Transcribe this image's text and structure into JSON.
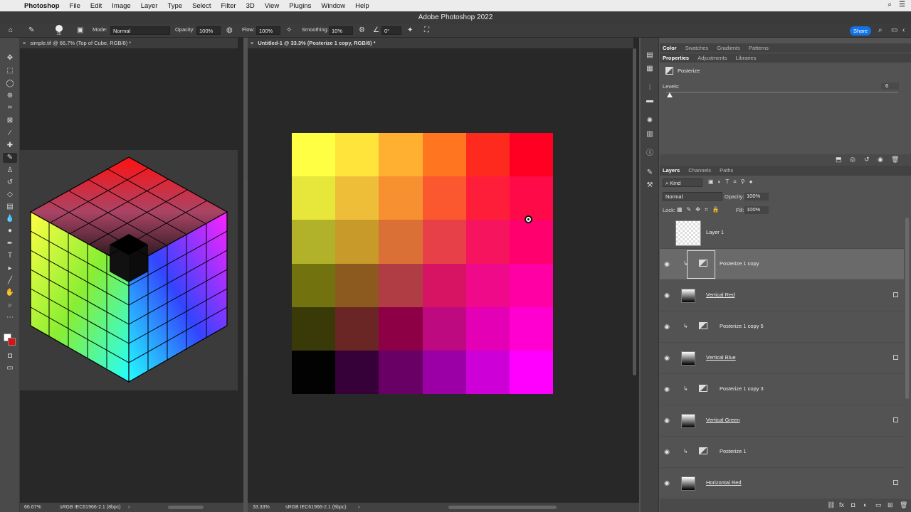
{
  "menubar": {
    "apple": "",
    "app": "Photoshop",
    "items": [
      "File",
      "Edit",
      "Image",
      "Layer",
      "Type",
      "Select",
      "Filter",
      "3D",
      "View",
      "Plugins",
      "Window",
      "Help"
    ],
    "right_icons": [
      "search-icon",
      "control-center-icon"
    ]
  },
  "window": {
    "title": "Adobe Photoshop 2022"
  },
  "options": {
    "brush_size": "25",
    "mode_label": "Mode:",
    "mode_value": "Normal",
    "opacity_label": "Opacity:",
    "opacity_value": "100%",
    "flow_label": "Flow:",
    "flow_value": "100%",
    "smoothing_label": "Smoothing:",
    "smoothing_value": "10%",
    "angle_value": "0°",
    "share_label": "Share"
  },
  "docs": [
    {
      "tab": "simple.tif @ 66.7% (Top of Cube, RGB/8) *",
      "zoom": "66.67%",
      "profile": "sRGB IEC61966-2.1 (8bpc)"
    },
    {
      "tab": "Untitled-1 @ 33.3% (Posterize 1 copy, RGB/8) *",
      "zoom": "33.33%",
      "profile": "sRGB IEC61966-2.1 (8bpc)"
    }
  ],
  "grid_colors": [
    [
      "#ffff44",
      "#ffe43c",
      "#ffb030",
      "#ff7520",
      "#ff2a1e",
      "#ff0022"
    ],
    [
      "#e7e63a",
      "#efbe38",
      "#f79030",
      "#fb5830",
      "#ff1e3a",
      "#ff0a48"
    ],
    [
      "#b2b22a",
      "#c89a2a",
      "#db7036",
      "#e84048",
      "#f6145e",
      "#ff006e"
    ],
    [
      "#72720e",
      "#8c5a1e",
      "#b03c44",
      "#d61463",
      "#ee0a88",
      "#ff00a4"
    ],
    [
      "#3a3a08",
      "#6a2624",
      "#8e0046",
      "#be0a80",
      "#e400b4",
      "#ff00d0"
    ],
    [
      "#020202",
      "#360038",
      "#680066",
      "#9a00a6",
      "#ce00d8",
      "#ff00ff"
    ]
  ],
  "panels": {
    "top_tabs": [
      "Color",
      "Swatches",
      "Gradients",
      "Patterns"
    ],
    "prop_tabs": [
      "Properties",
      "Adjustments",
      "Libraries"
    ],
    "prop_title": "Posterize",
    "levels_label": "Levels:",
    "levels_value": "6",
    "layers_tabs": [
      "Layers",
      "Channels",
      "Paths"
    ],
    "kind_label": "Kind",
    "blend_mode": "Normal",
    "opacity_label": "Opacity:",
    "opacity_value": "100%",
    "lock_label": "Lock:",
    "fill_label": "Fill:",
    "fill_value": "100%",
    "layers": [
      {
        "name": "Layer 1",
        "type": "pixel-empty",
        "visible": false,
        "selected": false,
        "underline": false
      },
      {
        "name": "Posterize 1 copy",
        "type": "adjustment",
        "visible": true,
        "selected": true,
        "underline": false
      },
      {
        "name": "Vertical Red",
        "type": "gradient",
        "visible": true,
        "selected": false,
        "underline": true
      },
      {
        "name": "Posterize 1 copy 5",
        "type": "adjustment",
        "visible": true,
        "selected": false,
        "underline": false
      },
      {
        "name": "Vertical Blue",
        "type": "gradient",
        "visible": true,
        "selected": false,
        "underline": true
      },
      {
        "name": "Posterize 1 copy 3",
        "type": "adjustment",
        "visible": true,
        "selected": false,
        "underline": false
      },
      {
        "name": "Vertical Green",
        "type": "gradient",
        "visible": true,
        "selected": false,
        "underline": true
      },
      {
        "name": "Posterize 1",
        "type": "adjustment",
        "visible": true,
        "selected": false,
        "underline": false
      },
      {
        "name": "Horizontal Red",
        "type": "gradient",
        "visible": true,
        "selected": false,
        "underline": true
      }
    ]
  }
}
